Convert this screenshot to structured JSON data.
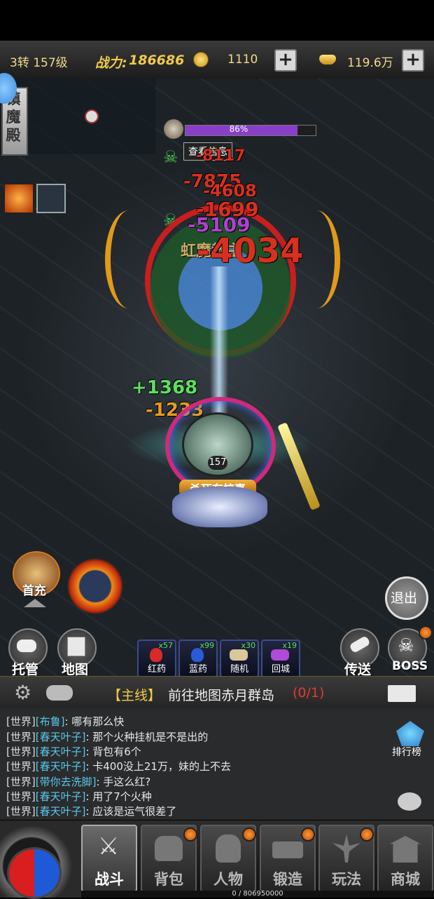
{
  "top": {
    "level_text": "3转 157级",
    "power_label": "战力:",
    "power_value": "186686",
    "currency1_value": "1110",
    "currency2_value": "119.6万",
    "plus": "+"
  },
  "map_name": "镇魔殿",
  "target": {
    "hp_percent": 86,
    "hp_text": "86%",
    "view_info_label": "查看信息",
    "name_fragment": "虹魔教主"
  },
  "damage_numbers": [
    "-7875",
    "-4608",
    "-1699",
    "-5109",
    "-4034",
    "+1368",
    "-1233",
    "-8117"
  ],
  "player": {
    "level_badge": "157",
    "banner": "杀死有惊喜"
  },
  "left_buttons": {
    "first_charge": "首充",
    "auto": "托管",
    "map": "地图"
  },
  "right_buttons": {
    "exit": "退出",
    "teleport": "传送",
    "boss": "BOSS"
  },
  "items": [
    {
      "label": "红药",
      "count": "x57"
    },
    {
      "label": "蓝药",
      "count": "x99"
    },
    {
      "label": "随机",
      "count": "x30"
    },
    {
      "label": "回城",
      "count": "x19"
    }
  ],
  "quest": {
    "tag": "【主线】",
    "text": "前往地图赤月群岛",
    "progress": "(0/1)"
  },
  "ranking_label": "排行榜",
  "chat": [
    {
      "channel": "[世界]",
      "name": "[布鲁]",
      "text": ": 哪有那么快"
    },
    {
      "channel": "[世界]",
      "name": "[春天叶子]",
      "text": ": 那个火种挂机是不是出的"
    },
    {
      "channel": "[世界]",
      "name": "[春天叶子]",
      "text": ": 背包有6个"
    },
    {
      "channel": "[世界]",
      "name": "[春天叶子]",
      "text": ": 卡400没上21万，妹的上不去"
    },
    {
      "channel": "[世界]",
      "name": "[带你去洗脚]",
      "text": ": 手这么红?"
    },
    {
      "channel": "[世界]",
      "name": "[春天叶子]",
      "text": ": 用了7个火种"
    },
    {
      "channel": "[世界]",
      "name": "[春天叶子]",
      "text": ": 应该是运气很差了"
    }
  ],
  "nav": [
    {
      "label": "战斗",
      "badge": false,
      "active": true
    },
    {
      "label": "背包",
      "badge": true
    },
    {
      "label": "人物",
      "badge": true
    },
    {
      "label": "锻造",
      "badge": true
    },
    {
      "label": "玩法",
      "badge": true
    },
    {
      "label": "商城",
      "badge": false
    }
  ],
  "exp_text": "0 / 806950000",
  "colors": {
    "accent_gold": "#f2c94c",
    "hp_bar": "#8a3fc8",
    "quest_red": "#e53935",
    "chat_name": "#5ac8e8",
    "heal_green": "#5fe05f",
    "damage_red": "#d83020"
  }
}
